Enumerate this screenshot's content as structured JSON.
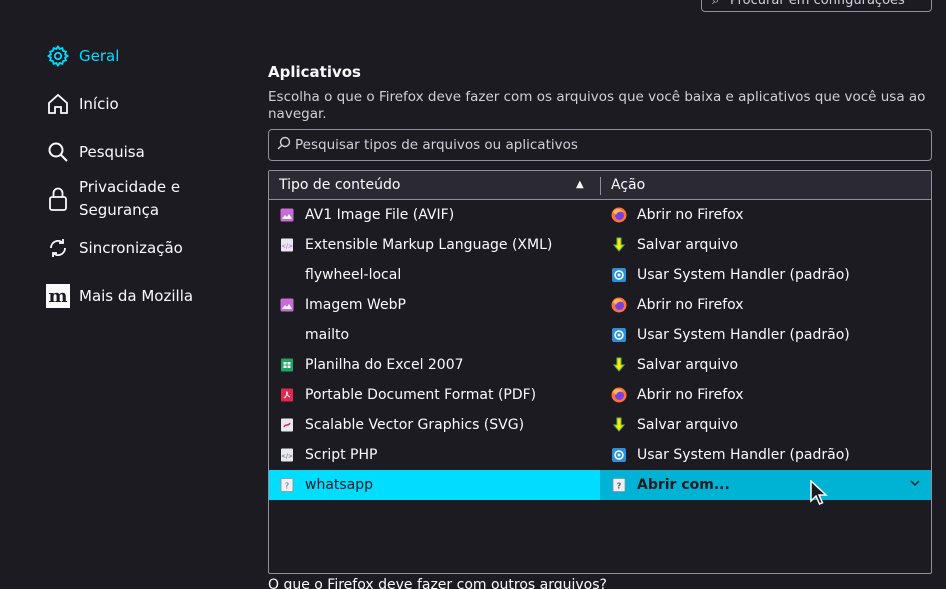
{
  "top_search": {
    "placeholder": "Procurar em configurações"
  },
  "sidebar": {
    "items": [
      {
        "label": "Geral",
        "icon": "gear-icon",
        "selected": true
      },
      {
        "label": "Início",
        "icon": "home-icon"
      },
      {
        "label": "Pesquisa",
        "icon": "search-icon"
      },
      {
        "label": "Privacidade e Segurança",
        "line1": "Privacidade e",
        "line2": "Segurança",
        "icon": "lock-icon"
      },
      {
        "label": "Sincronização",
        "icon": "sync-icon"
      },
      {
        "label": "Mais da Mozilla",
        "icon": "mozilla-icon",
        "icon_text": "m"
      }
    ]
  },
  "main": {
    "title": "Aplicativos",
    "description": "Escolha o que o Firefox deve fazer com os arquivos que você baixa e aplicativos que você usa ao navegar.",
    "filter_placeholder": "Pesquisar tipos de arquivos ou aplicativos",
    "table": {
      "col_type": "Tipo de conteúdo",
      "col_action": "Ação",
      "sort_indicator": "▲",
      "rows": [
        {
          "type": "AV1 Image File (AVIF)",
          "type_icon": "image-file-icon",
          "action": "Abrir no Firefox",
          "action_icon": "firefox-icon"
        },
        {
          "type": "Extensible Markup Language (XML)",
          "type_icon": "xml-file-icon",
          "action": "Salvar arquivo",
          "action_icon": "download-icon"
        },
        {
          "type": "flywheel-local",
          "type_icon": "",
          "action": "Usar System Handler (padrão)",
          "action_icon": "system-handler-icon"
        },
        {
          "type": "Imagem WebP",
          "type_icon": "image-file-icon",
          "action": "Abrir no Firefox",
          "action_icon": "firefox-icon"
        },
        {
          "type": "mailto",
          "type_icon": "",
          "action": "Usar System Handler (padrão)",
          "action_icon": "system-handler-icon"
        },
        {
          "type": "Planilha do Excel 2007",
          "type_icon": "spreadsheet-file-icon",
          "action": "Salvar arquivo",
          "action_icon": "download-icon"
        },
        {
          "type": "Portable Document Format (PDF)",
          "type_icon": "pdf-file-icon",
          "action": "Abrir no Firefox",
          "action_icon": "firefox-icon"
        },
        {
          "type": "Scalable Vector Graphics (SVG)",
          "type_icon": "svg-file-icon",
          "action": "Salvar arquivo",
          "action_icon": "download-icon"
        },
        {
          "type": "Script PHP",
          "type_icon": "code-file-icon",
          "action": "Usar System Handler (padrão)",
          "action_icon": "system-handler-icon"
        },
        {
          "type": "whatsapp",
          "type_icon": "unknown-file-icon",
          "action": "Abrir com...",
          "action_icon": "unknown-file-icon",
          "selected": true
        }
      ]
    }
  },
  "bottom_text": "O que o Firefox deve fazer com outros arquivos?",
  "colors": {
    "background": "#1c1b22",
    "accent": "#00ddff",
    "selected_action_bg": "#00b3d4",
    "text": "#fbfbfe"
  }
}
